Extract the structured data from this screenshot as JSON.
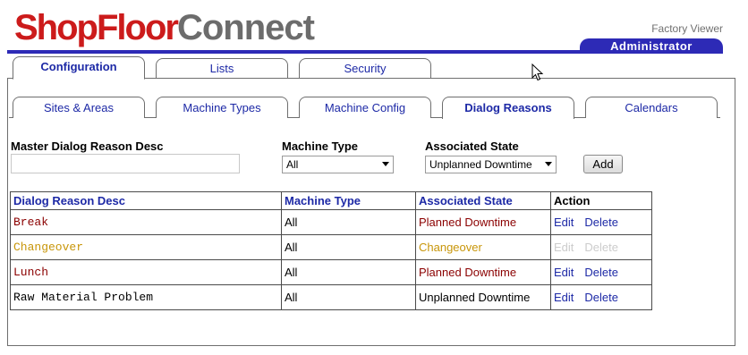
{
  "header": {
    "logo_part1": "ShopFloor",
    "logo_part2": "Connect",
    "factory_viewer": "Factory Viewer",
    "role": "Administrator"
  },
  "tabs": [
    {
      "label": "Configuration",
      "active": true
    },
    {
      "label": "Lists",
      "active": false
    },
    {
      "label": "Security",
      "active": false
    }
  ],
  "subtabs": [
    {
      "label": "Sites & Areas",
      "active": false
    },
    {
      "label": "Machine Types",
      "active": false
    },
    {
      "label": "Machine Config",
      "active": false
    },
    {
      "label": "Dialog Reasons",
      "active": true
    },
    {
      "label": "Calendars",
      "active": false
    }
  ],
  "form": {
    "master_label": "Master Dialog Reason Desc",
    "master_value": "",
    "machine_type_label": "Machine Type",
    "machine_type_value": "All",
    "state_label": "Associated State",
    "state_value": "Unplanned Downtime",
    "add_label": "Add"
  },
  "table": {
    "headers": [
      "Dialog Reason Desc",
      "Machine Type",
      "Associated State",
      "Action"
    ],
    "rows": [
      {
        "desc": "Break",
        "machine": "All",
        "state": "Planned Downtime",
        "edit": "Edit",
        "delete": "Delete",
        "color": "#8b0000",
        "actions_enabled": true
      },
      {
        "desc": "Changeover",
        "machine": "All",
        "state": "Changeover",
        "edit": "Edit",
        "delete": "Delete",
        "color": "#c8960a",
        "actions_enabled": false
      },
      {
        "desc": "Lunch",
        "machine": "All",
        "state": "Planned Downtime",
        "edit": "Edit",
        "delete": "Delete",
        "color": "#8b0000",
        "actions_enabled": true
      },
      {
        "desc": "Raw Material Problem",
        "machine": "All",
        "state": "Unplanned Downtime",
        "edit": "Edit",
        "delete": "Delete",
        "color": "#000000",
        "actions_enabled": true
      }
    ]
  },
  "colors": {
    "brand_red": "#cc1b1b",
    "brand_gray": "#6c6c6c",
    "accent_blue": "#2d2ab6",
    "link_blue": "#1d29a6"
  }
}
